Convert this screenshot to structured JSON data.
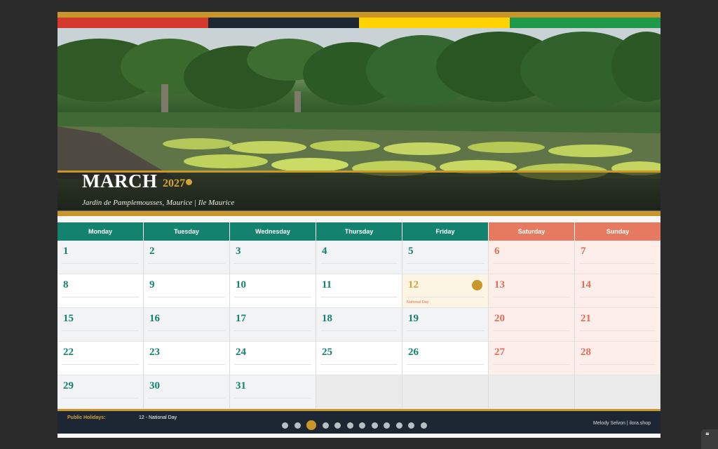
{
  "flag_colors": [
    "#d33a2c",
    "#1c2733",
    "#ffd200",
    "#1f9a4b"
  ],
  "hero": {
    "month": "MARCH",
    "year": "2027",
    "location": "Jardin de Pamplemousses, Maurice  |  Ile Maurice"
  },
  "weekdays": [
    "Monday",
    "Tuesday",
    "Wednesday",
    "Thursday",
    "Friday",
    "Saturday",
    "Sunday"
  ],
  "weeks": [
    [
      "1",
      "2",
      "3",
      "4",
      "5",
      "6",
      "7"
    ],
    [
      "8",
      "9",
      "10",
      "11",
      "12",
      "13",
      "14"
    ],
    [
      "15",
      "16",
      "17",
      "18",
      "19",
      "20",
      "21"
    ],
    [
      "22",
      "23",
      "24",
      "25",
      "26",
      "27",
      "28"
    ],
    [
      "29",
      "30",
      "31",
      "",
      "",
      "",
      ""
    ]
  ],
  "holiday": {
    "day": "12",
    "name": "National Day"
  },
  "footer": {
    "holidays_label": "Public Holidays:",
    "holidays_value": "12 - National Day",
    "credit": "Melody Selvon  |  ilora.shop"
  },
  "pagination": {
    "total": 12,
    "active": 3
  },
  "corner_widget": {
    "icon": "quote-icon"
  }
}
